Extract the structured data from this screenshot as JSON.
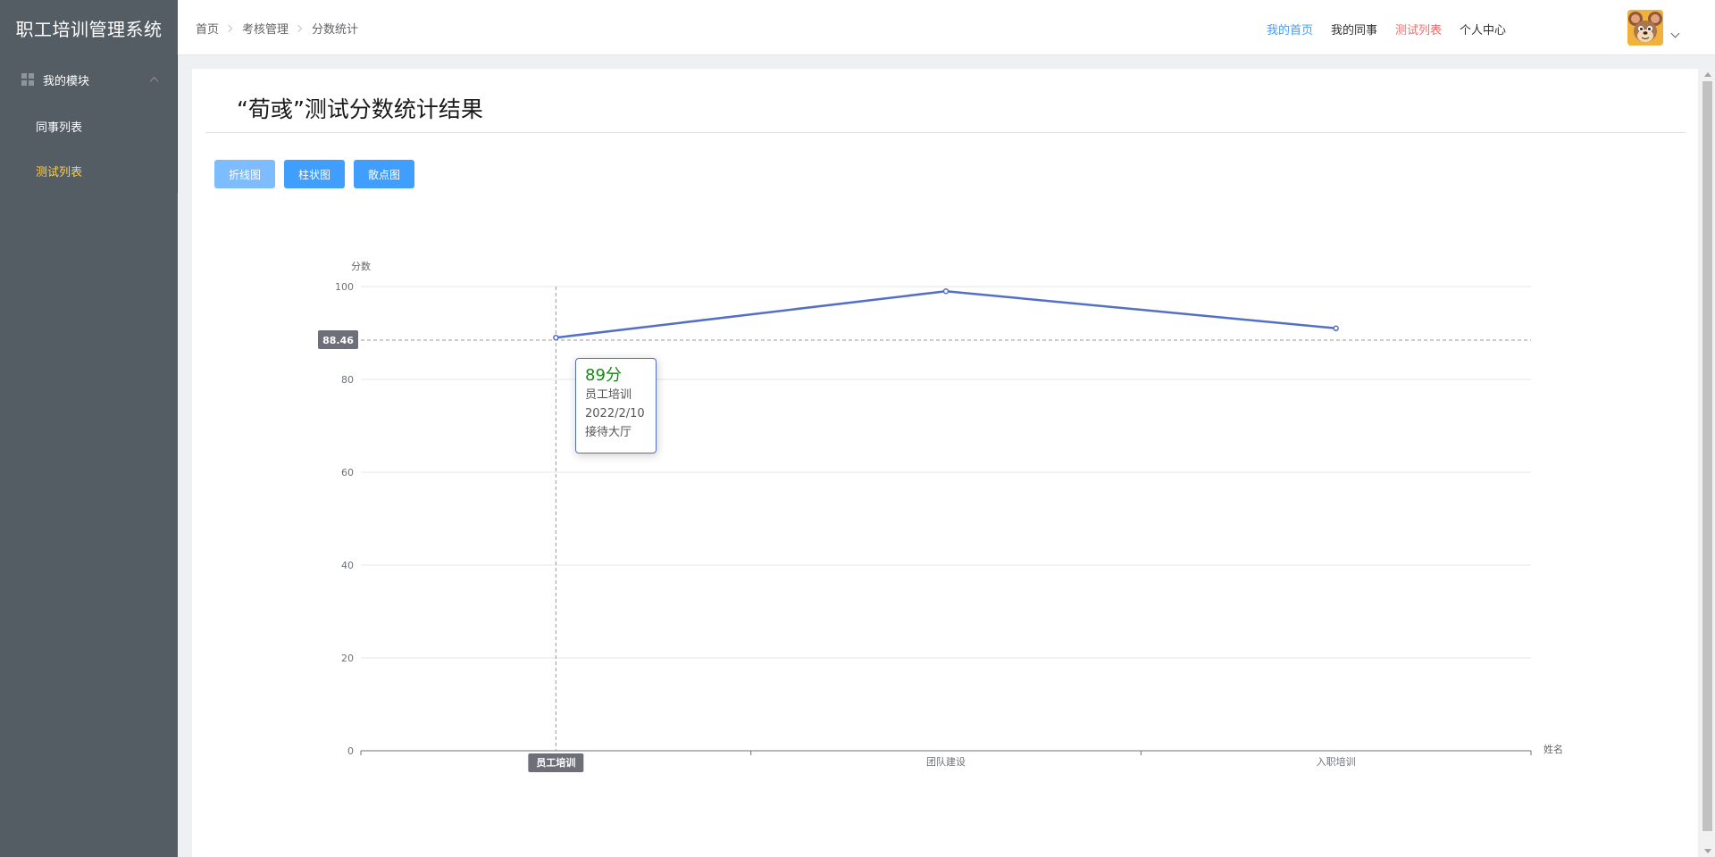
{
  "sidebar": {
    "brand": "职工培训管理系统",
    "submenu_title": "我的模块",
    "items": [
      {
        "label": "同事列表",
        "active": false
      },
      {
        "label": "测试列表",
        "active": true
      }
    ],
    "colors": {
      "background": "#545c64",
      "active_text": "#ffd04b"
    }
  },
  "header": {
    "breadcrumb": [
      "首页",
      "考核管理",
      "分数统计"
    ],
    "nav": [
      {
        "label": "我的首页",
        "color": "#409eff"
      },
      {
        "label": "我的同事",
        "color": "#303133"
      },
      {
        "label": "测试列表",
        "color": "#f56c6c"
      },
      {
        "label": "个人中心",
        "color": "#303133"
      }
    ],
    "avatar_icon": "cartoon-mouse-avatar"
  },
  "main": {
    "title": "“荀彧”测试分数统计结果",
    "buttons": [
      {
        "label": "折线图",
        "disabled": true
      },
      {
        "label": "柱状图",
        "disabled": false
      },
      {
        "label": "散点图",
        "disabled": false
      }
    ]
  },
  "tooltip": {
    "score": "89分",
    "name": "员工培训",
    "date": "2022/2/10",
    "place": "接待大厅"
  },
  "chart_data": {
    "type": "line",
    "categories": [
      "员工培训",
      "团队建设",
      "入职培训"
    ],
    "series": [
      {
        "values": [
          89,
          99,
          91
        ],
        "color": "#5470c6"
      }
    ],
    "xlabel": "姓名",
    "ylabel": "分数",
    "ylim": [
      0,
      100
    ],
    "yticks": [
      0,
      20,
      40,
      60,
      80,
      100
    ],
    "grid": true,
    "axis_pointer": {
      "y_value_label": "88.46",
      "x_category": "员工培训"
    }
  }
}
